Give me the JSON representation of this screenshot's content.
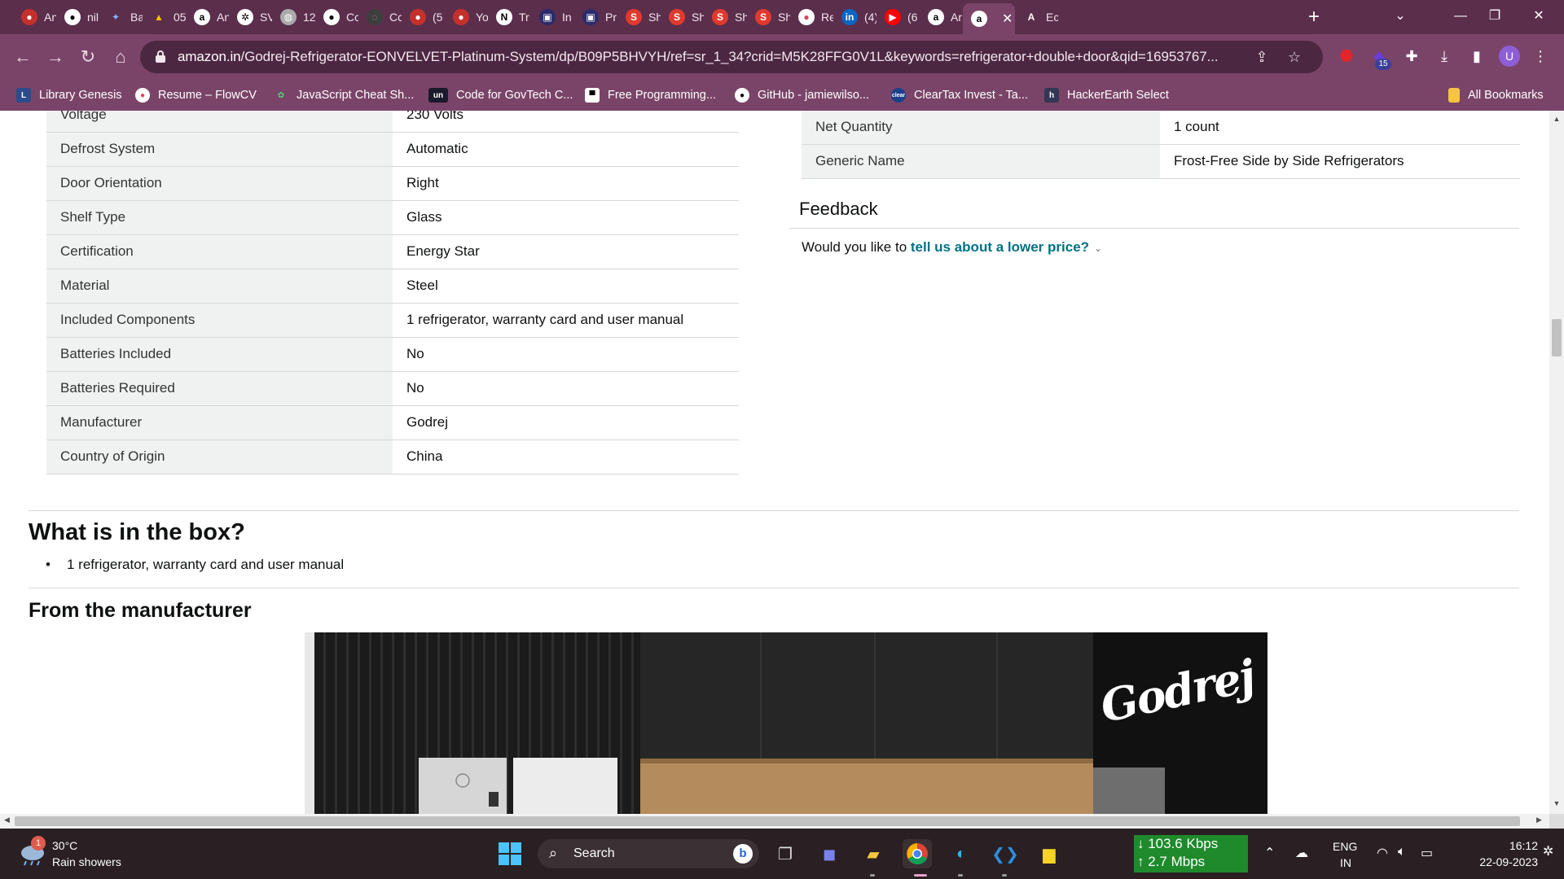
{
  "tabs": [
    {
      "label": "An",
      "icon": "youtube-red-icon"
    },
    {
      "label": "nil",
      "icon": "github-icon"
    },
    {
      "label": "Ba",
      "icon": "bard-icon"
    },
    {
      "label": "05",
      "icon": "google-drive-icon"
    },
    {
      "label": "An",
      "icon": "amazon-icon"
    },
    {
      "label": "SV",
      "icon": "chatgpt-icon"
    },
    {
      "label": "12",
      "icon": "globe-icon"
    },
    {
      "label": "Cc",
      "icon": "github-icon"
    },
    {
      "label": "Cc",
      "icon": "circle-icon"
    },
    {
      "label": "(5",
      "icon": "youtube-red-icon"
    },
    {
      "label": "Yo",
      "icon": "youtube-red-icon"
    },
    {
      "label": "Tr",
      "icon": "notion-icon"
    },
    {
      "label": "In",
      "icon": "tab-icon"
    },
    {
      "label": "Pr",
      "icon": "tab-icon"
    },
    {
      "label": "Sh",
      "icon": "s-icon"
    },
    {
      "label": "Sh",
      "icon": "s-icon"
    },
    {
      "label": "Sh",
      "icon": "s-icon"
    },
    {
      "label": "Sh",
      "icon": "s-icon"
    },
    {
      "label": "Re",
      "icon": "flowcv-icon"
    },
    {
      "label": "(4)",
      "icon": "linkedin-icon"
    },
    {
      "label": "(6",
      "icon": "youtube-icon"
    },
    {
      "label": "Ar",
      "icon": "amazon-icon"
    },
    {
      "label": "",
      "icon": "amazon-icon",
      "active": true
    },
    {
      "label": "Ec",
      "icon": "a-icon"
    }
  ],
  "address_bar": {
    "host": "amazon.in",
    "path": "/Godrej-Refrigerator-EONVELVET-Platinum-System/dp/B09P5BHVYH/ref=sr_1_34?crid=M5K28FFG0V1L&keywords=refrigerator+double+door&qid=16953767..."
  },
  "extension_badge": "15",
  "profile_initial": "U",
  "bookmarks": [
    "Library Genesis",
    "Resume – FlowCV",
    "JavaScript Cheat Sh...",
    "Code for GovTech C...",
    "Free Programming...",
    "GitHub - jamiewilso...",
    "ClearTax Invest - Ta...",
    "HackerEarth Select"
  ],
  "all_bookmarks": "All Bookmarks",
  "specs_left": [
    {
      "key": "Voltage",
      "value": "230 Volts"
    },
    {
      "key": "Defrost System",
      "value": "Automatic"
    },
    {
      "key": "Door Orientation",
      "value": "Right"
    },
    {
      "key": "Shelf Type",
      "value": "Glass"
    },
    {
      "key": "Certification",
      "value": "Energy Star"
    },
    {
      "key": "Material",
      "value": "Steel"
    },
    {
      "key": "Included Components",
      "value": "1 refrigerator, warranty card and user manual"
    },
    {
      "key": "Batteries Included",
      "value": "No"
    },
    {
      "key": "Batteries Required",
      "value": "No"
    },
    {
      "key": "Manufacturer",
      "value": "Godrej"
    },
    {
      "key": "Country of Origin",
      "value": "China"
    }
  ],
  "specs_right": [
    {
      "key": "Net Quantity",
      "value": "1 count"
    },
    {
      "key": "Generic Name",
      "value": "Frost-Free Side by Side Refrigerators"
    }
  ],
  "feedback": {
    "title": "Feedback",
    "prefix": "Would you like to ",
    "link": "tell us about a lower price?"
  },
  "in_the_box": {
    "title": "What is in the box?",
    "items": [
      "1 refrigerator, warranty card and user manual"
    ]
  },
  "manufacturer_section": {
    "title": "From the manufacturer",
    "logo_text": "Godrej"
  },
  "taskbar": {
    "weather_badge": "1",
    "temperature": "30°C",
    "condition": "Rain showers",
    "search_label": "Search",
    "net_down": "↓ 103.6 Kbps",
    "net_up": "↑ 2.7 Mbps",
    "lang_line1": "ENG",
    "lang_line2": "IN",
    "time": "16:12",
    "date": "22-09-2023"
  }
}
